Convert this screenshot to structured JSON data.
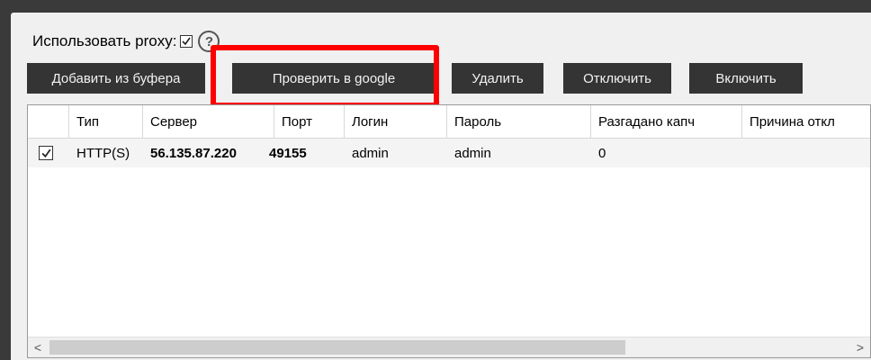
{
  "proxy_section": {
    "use_proxy_label": "Использовать proxy:",
    "use_proxy_checked": true,
    "help_glyph": "?"
  },
  "toolbar": {
    "add_from_buffer": "Добавить из буфера",
    "check_google": "Проверить в google",
    "delete": "Удалить",
    "disable": "Отключить",
    "enable": "Включить"
  },
  "table": {
    "columns": [
      "Тип",
      "Сервер",
      "Порт",
      "Логин",
      "Пароль",
      "Разгадано капч",
      "Причина откл"
    ],
    "rows": [
      {
        "checked": true,
        "type": "HTTP(S)",
        "server": "56.135.87.220",
        "port": "49155",
        "login": "admin",
        "password": "admin",
        "captchas_solved": "0",
        "disable_reason": ""
      }
    ]
  },
  "scrollbar": {
    "left_arrow": "<",
    "right_arrow": ">"
  },
  "colors": {
    "button_bg": "#343434",
    "highlight": "#ff0000"
  },
  "icons": [
    "checkbox-checked-icon",
    "help-icon",
    "chevron-left-icon",
    "chevron-right-icon"
  ]
}
